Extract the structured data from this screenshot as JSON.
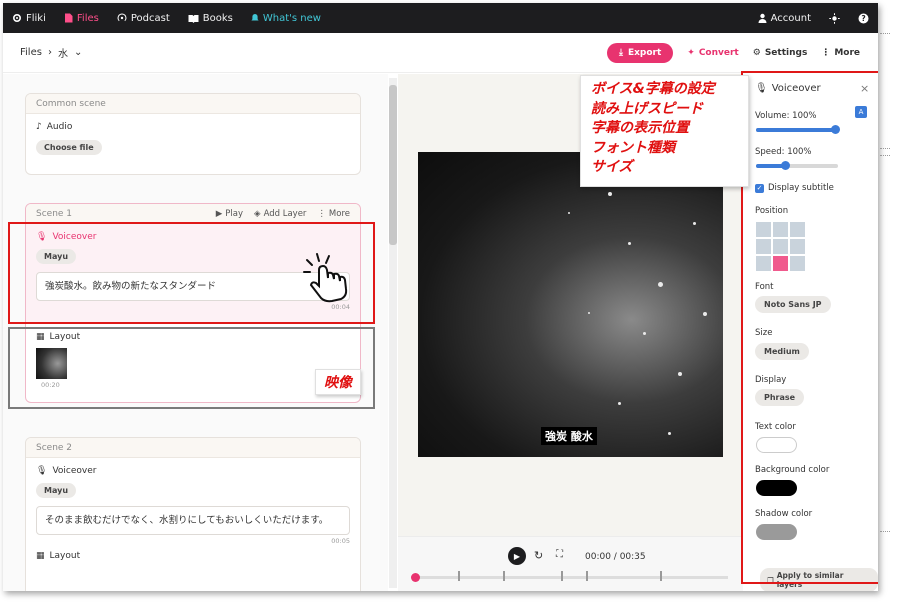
{
  "nav": {
    "brand": "Fliki",
    "files": "Files",
    "podcast": "Podcast",
    "books": "Books",
    "whats_new": "What's new",
    "account": "Account"
  },
  "header": {
    "crumb_root": "Files",
    "crumb_current": "水",
    "export": "Export",
    "convert": "Convert",
    "settings": "Settings",
    "more": "More"
  },
  "common_scene": {
    "title": "Common scene",
    "audio_label": "Audio",
    "choose_file": "Choose file"
  },
  "scene1": {
    "title": "Scene 1",
    "play": "Play",
    "add_layer": "Add Layer",
    "more": "More",
    "voiceover_label": "Voiceover",
    "voice": "Mayu",
    "text": "強炭酸水。飲み物の新たなスタンダード",
    "voice_duration": "00:04",
    "layout_label": "Layout",
    "layout_duration": "00:20"
  },
  "scene2": {
    "title": "Scene 2",
    "voiceover_label": "Voiceover",
    "voice": "Mayu",
    "text": "そのまま飲むだけでなく、水割りにしてもおいしくいただけます。",
    "voice_duration": "00:05",
    "layout_label": "Layout"
  },
  "annotations": {
    "callout_lines": [
      "ボイス&字幕の設定",
      "読み上げスピード",
      "字幕の表示位置",
      "フォント種類",
      "サイズ"
    ],
    "video_label": "映像"
  },
  "preview": {
    "subtitle": "強炭 酸水",
    "time": "00:00 / 00:35"
  },
  "panel": {
    "title": "Voiceover",
    "volume_label": "Volume: 100%",
    "volume": 1.0,
    "speed_label": "Speed: 100%",
    "display_subtitle": "Display subtitle",
    "position_label": "Position",
    "font_label": "Font",
    "font_value": "Noto Sans JP",
    "size_label": "Size",
    "size_value": "Medium",
    "display_label": "Display",
    "display_value": "Phrase",
    "text_color_label": "Text color",
    "text_color": "#ffffff",
    "bg_color_label": "Background color",
    "bg_color": "#000000",
    "shadow_color_label": "Shadow color",
    "shadow_color": "#9a9a9a",
    "apply": "Apply to similar layers"
  },
  "colors": {
    "accent": "#e8336f",
    "slider": "#3b7bd8",
    "annotation_red": "#e01818"
  }
}
